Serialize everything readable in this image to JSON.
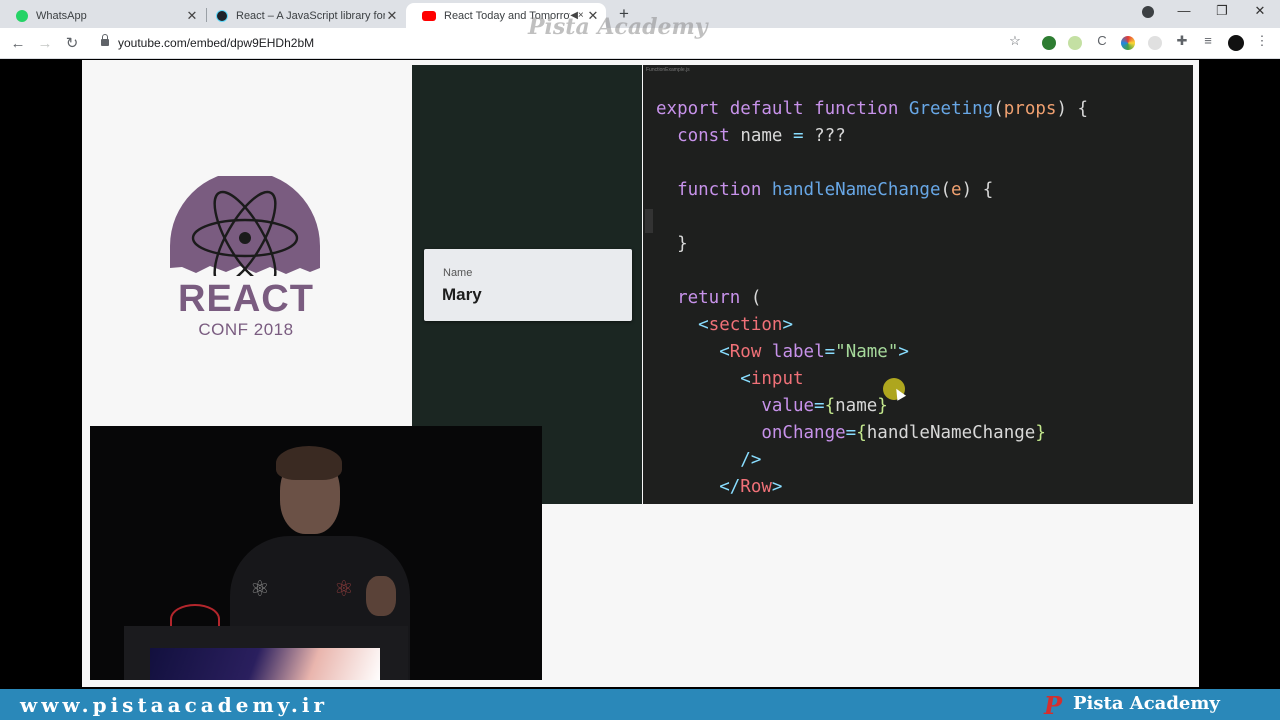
{
  "browser": {
    "tabs": [
      {
        "title": "WhatsApp",
        "icon": "whatsapp-icon",
        "color": "#25d366"
      },
      {
        "title": "React – A JavaScript library for bu",
        "icon": "react-icon",
        "color": "#20232a"
      },
      {
        "title": "React Today and Tomorrow a",
        "icon": "youtube-icon",
        "color": "#ff0000",
        "active": true
      }
    ],
    "new_tab": "+",
    "url": "youtube.com/embed/dpw9EHDh2bM",
    "watermark": "Pista Academy"
  },
  "slide": {
    "conference": {
      "name": "REACT",
      "subtitle": "CONF 2018",
      "color": "#7a5c80"
    },
    "demo_field": {
      "label": "Name",
      "value": "Mary"
    },
    "editor": {
      "filename": "FunctionExample.js",
      "code_lines": [
        "export default function Greeting(props) {",
        "  const name = ???",
        "",
        "  function handleNameChange(e) {",
        "",
        "  }",
        "",
        "  return (",
        "    <section>",
        "      <Row label=\"Name\">",
        "        <input",
        "          value={name}",
        "          onChange={handleNameChange}",
        "        />",
        "      </Row>"
      ]
    }
  },
  "footer": {
    "url": "www.pistaacademy.ir",
    "brand": "Pista Academy",
    "brand_logo_letter": "P",
    "color": "#2a88b9"
  }
}
